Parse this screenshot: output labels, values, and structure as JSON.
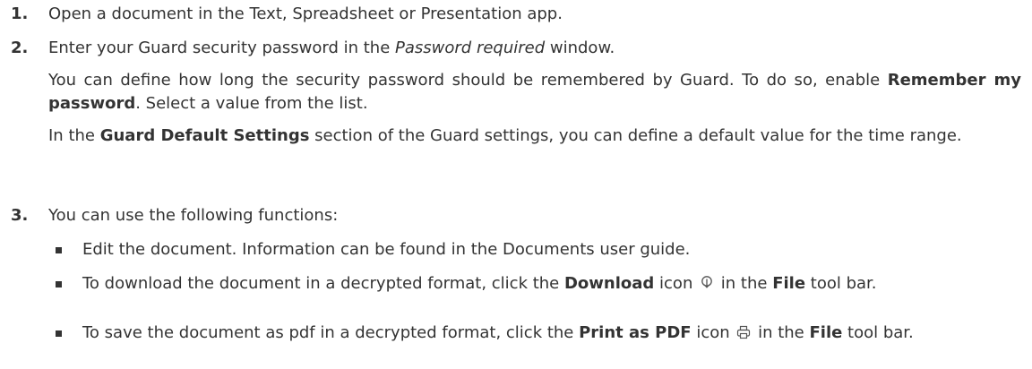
{
  "steps": [
    {
      "num": "1.",
      "text": "Open a document in the Text, Spreadsheet or Presentation app."
    },
    {
      "num": "2.",
      "text_before": "Enter your Guard security password in the ",
      "text_italic": "Password required",
      "text_after": " window.",
      "notes": [
        {
          "before": "You can define how long the security password should be remembered by Guard. To do so, enable ",
          "bold": "Remember my password",
          "after": ". Select a value from the list."
        },
        {
          "before": "In the ",
          "bold": "Guard Default Settings",
          "after": " section of the Guard settings, you can define a default value for the time range."
        }
      ]
    },
    {
      "num": "3.",
      "text": "You can use the following functions:",
      "bullets": [
        {
          "text": "Edit the document. Information can be found in the Documents user guide."
        },
        {
          "before": "To download the document in a decrypted format, click the ",
          "bold1": "Download",
          "middle": " icon ",
          "icon": "download-icon",
          "after_icon": " in the ",
          "bold2": "File",
          "end": " tool bar."
        },
        {
          "before": "To save the document as pdf in a decrypted format, click the ",
          "bold1": "Print as PDF",
          "middle": " icon ",
          "icon": "print-icon",
          "after_icon": " in the ",
          "bold2": "File",
          "end": " tool bar."
        }
      ]
    }
  ],
  "colors": {
    "text": "#333333",
    "background": "#ffffff"
  }
}
